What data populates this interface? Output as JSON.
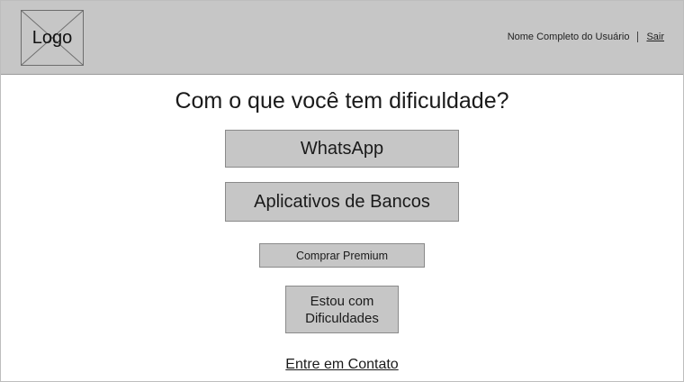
{
  "header": {
    "logo_label": "Logo",
    "user_name": "Nome Completo do Usuário",
    "logout_label": "Sair"
  },
  "main": {
    "title": "Com o que você tem dificuldade?",
    "buttons": {
      "whatsapp": "WhatsApp",
      "banks": "Aplicativos de Bancos",
      "premium": "Comprar Premium",
      "help": "Estou com Dificuldades"
    },
    "contact_link": "Entre em Contato"
  },
  "colors": {
    "header_bg": "#c6c6c6",
    "button_bg": "#c6c6c6",
    "page_bg": "#ffffff"
  }
}
